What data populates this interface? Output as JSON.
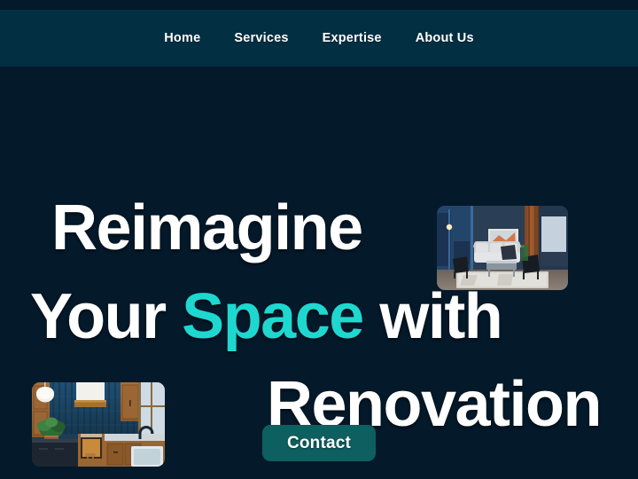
{
  "colors": {
    "page_bg": "#04192a",
    "nav_bg": "#032f43",
    "heading_text": "#ffffff",
    "accent": "#1ed8d0",
    "cta_bg": "#0e5f60",
    "cta_text": "#ffffff"
  },
  "nav": {
    "items": [
      {
        "label": "Home"
      },
      {
        "label": "Services"
      },
      {
        "label": "Expertise"
      },
      {
        "label": "About Us"
      }
    ]
  },
  "hero": {
    "headline": {
      "line1": "Reimagine",
      "line2_before": "Your ",
      "line2_accent": "Space",
      "line2_after": " with",
      "line3": "Renovation"
    },
    "cta": {
      "label": "Contact"
    },
    "images": [
      {
        "name": "living-room-photo",
        "alt": "Modern living room with blue walls, white sectional sofa, black accent chairs and wood paneling"
      },
      {
        "name": "kitchen-photo",
        "alt": "Kitchen with blue vertical tile backsplash, wood cabinets, white range hood, potted plant and sink"
      }
    ]
  }
}
